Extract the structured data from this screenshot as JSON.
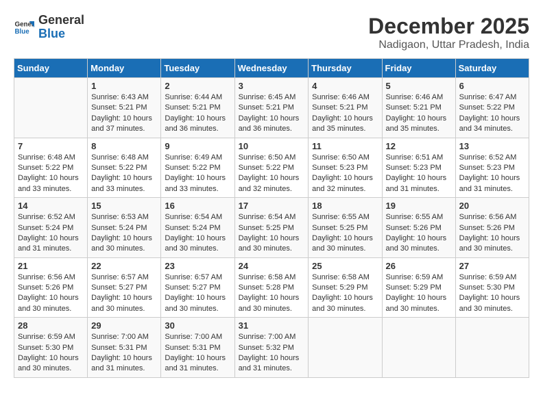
{
  "header": {
    "logo_line1": "General",
    "logo_line2": "Blue",
    "month": "December 2025",
    "location": "Nadigaon, Uttar Pradesh, India"
  },
  "days_of_week": [
    "Sunday",
    "Monday",
    "Tuesday",
    "Wednesday",
    "Thursday",
    "Friday",
    "Saturday"
  ],
  "weeks": [
    [
      {
        "day": "",
        "info": ""
      },
      {
        "day": "1",
        "info": "Sunrise: 6:43 AM\nSunset: 5:21 PM\nDaylight: 10 hours\nand 37 minutes."
      },
      {
        "day": "2",
        "info": "Sunrise: 6:44 AM\nSunset: 5:21 PM\nDaylight: 10 hours\nand 36 minutes."
      },
      {
        "day": "3",
        "info": "Sunrise: 6:45 AM\nSunset: 5:21 PM\nDaylight: 10 hours\nand 36 minutes."
      },
      {
        "day": "4",
        "info": "Sunrise: 6:46 AM\nSunset: 5:21 PM\nDaylight: 10 hours\nand 35 minutes."
      },
      {
        "day": "5",
        "info": "Sunrise: 6:46 AM\nSunset: 5:21 PM\nDaylight: 10 hours\nand 35 minutes."
      },
      {
        "day": "6",
        "info": "Sunrise: 6:47 AM\nSunset: 5:22 PM\nDaylight: 10 hours\nand 34 minutes."
      }
    ],
    [
      {
        "day": "7",
        "info": "Sunrise: 6:48 AM\nSunset: 5:22 PM\nDaylight: 10 hours\nand 33 minutes."
      },
      {
        "day": "8",
        "info": "Sunrise: 6:48 AM\nSunset: 5:22 PM\nDaylight: 10 hours\nand 33 minutes."
      },
      {
        "day": "9",
        "info": "Sunrise: 6:49 AM\nSunset: 5:22 PM\nDaylight: 10 hours\nand 33 minutes."
      },
      {
        "day": "10",
        "info": "Sunrise: 6:50 AM\nSunset: 5:22 PM\nDaylight: 10 hours\nand 32 minutes."
      },
      {
        "day": "11",
        "info": "Sunrise: 6:50 AM\nSunset: 5:23 PM\nDaylight: 10 hours\nand 32 minutes."
      },
      {
        "day": "12",
        "info": "Sunrise: 6:51 AM\nSunset: 5:23 PM\nDaylight: 10 hours\nand 31 minutes."
      },
      {
        "day": "13",
        "info": "Sunrise: 6:52 AM\nSunset: 5:23 PM\nDaylight: 10 hours\nand 31 minutes."
      }
    ],
    [
      {
        "day": "14",
        "info": "Sunrise: 6:52 AM\nSunset: 5:24 PM\nDaylight: 10 hours\nand 31 minutes."
      },
      {
        "day": "15",
        "info": "Sunrise: 6:53 AM\nSunset: 5:24 PM\nDaylight: 10 hours\nand 30 minutes."
      },
      {
        "day": "16",
        "info": "Sunrise: 6:54 AM\nSunset: 5:24 PM\nDaylight: 10 hours\nand 30 minutes."
      },
      {
        "day": "17",
        "info": "Sunrise: 6:54 AM\nSunset: 5:25 PM\nDaylight: 10 hours\nand 30 minutes."
      },
      {
        "day": "18",
        "info": "Sunrise: 6:55 AM\nSunset: 5:25 PM\nDaylight: 10 hours\nand 30 minutes."
      },
      {
        "day": "19",
        "info": "Sunrise: 6:55 AM\nSunset: 5:26 PM\nDaylight: 10 hours\nand 30 minutes."
      },
      {
        "day": "20",
        "info": "Sunrise: 6:56 AM\nSunset: 5:26 PM\nDaylight: 10 hours\nand 30 minutes."
      }
    ],
    [
      {
        "day": "21",
        "info": "Sunrise: 6:56 AM\nSunset: 5:26 PM\nDaylight: 10 hours\nand 30 minutes."
      },
      {
        "day": "22",
        "info": "Sunrise: 6:57 AM\nSunset: 5:27 PM\nDaylight: 10 hours\nand 30 minutes."
      },
      {
        "day": "23",
        "info": "Sunrise: 6:57 AM\nSunset: 5:27 PM\nDaylight: 10 hours\nand 30 minutes."
      },
      {
        "day": "24",
        "info": "Sunrise: 6:58 AM\nSunset: 5:28 PM\nDaylight: 10 hours\nand 30 minutes."
      },
      {
        "day": "25",
        "info": "Sunrise: 6:58 AM\nSunset: 5:29 PM\nDaylight: 10 hours\nand 30 minutes."
      },
      {
        "day": "26",
        "info": "Sunrise: 6:59 AM\nSunset: 5:29 PM\nDaylight: 10 hours\nand 30 minutes."
      },
      {
        "day": "27",
        "info": "Sunrise: 6:59 AM\nSunset: 5:30 PM\nDaylight: 10 hours\nand 30 minutes."
      }
    ],
    [
      {
        "day": "28",
        "info": "Sunrise: 6:59 AM\nSunset: 5:30 PM\nDaylight: 10 hours\nand 30 minutes."
      },
      {
        "day": "29",
        "info": "Sunrise: 7:00 AM\nSunset: 5:31 PM\nDaylight: 10 hours\nand 31 minutes."
      },
      {
        "day": "30",
        "info": "Sunrise: 7:00 AM\nSunset: 5:31 PM\nDaylight: 10 hours\nand 31 minutes."
      },
      {
        "day": "31",
        "info": "Sunrise: 7:00 AM\nSunset: 5:32 PM\nDaylight: 10 hours\nand 31 minutes."
      },
      {
        "day": "",
        "info": ""
      },
      {
        "day": "",
        "info": ""
      },
      {
        "day": "",
        "info": ""
      }
    ]
  ]
}
